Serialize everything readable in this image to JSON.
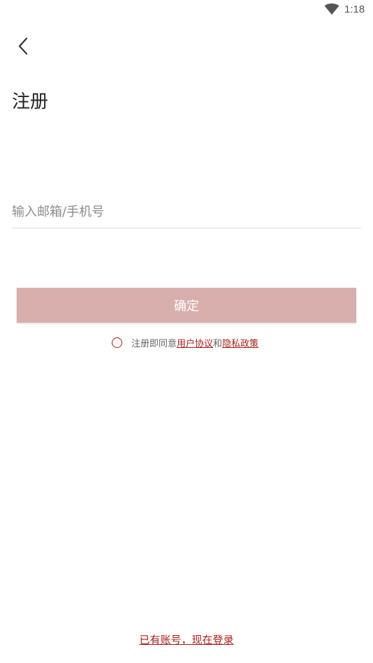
{
  "status_bar": {
    "time": "1:18",
    "wifi_icon": "wifi-icon"
  },
  "header": {
    "back_icon": "chevron-left-icon",
    "title": "注册"
  },
  "form": {
    "account_placeholder": "输入邮箱/手机号",
    "account_value": "",
    "confirm_label": "确定"
  },
  "agreement": {
    "checked": false,
    "prefix": "注册即同意",
    "user_agreement": "用户协议",
    "conjunction": "和",
    "privacy_policy": "隐私政策"
  },
  "footer": {
    "login_link": "已有账号，现在登录"
  },
  "colors": {
    "accent": "#a8201a",
    "button_bg": "#d9afad",
    "text_dark": "#222222",
    "placeholder": "#8c8c8c"
  }
}
